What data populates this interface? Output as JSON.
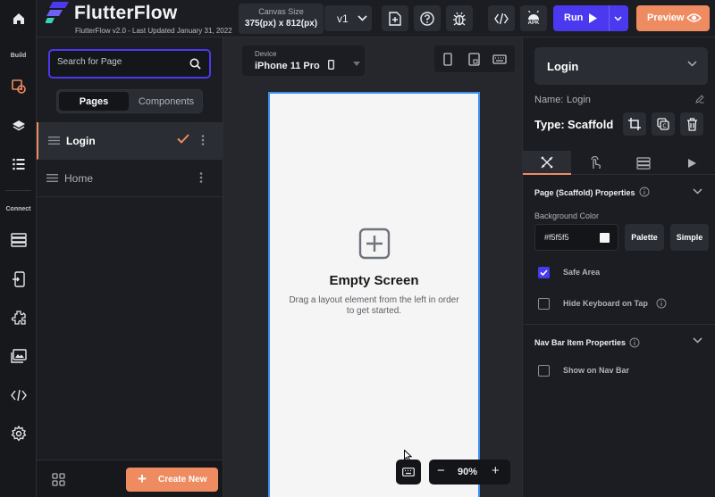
{
  "rail": {
    "build_label": "Build",
    "connect_label": "Connect"
  },
  "header": {
    "brand": "FlutterFlow",
    "version": "FlutterFlow v2.0 - Last Updated January 31, 2022",
    "canvas_size_label": "Canvas Size",
    "canvas_size_value": "375(px) x 812(px)",
    "version_select": "v1",
    "run_label": "Run",
    "preview_label": "Preview",
    "apk_label": "APK"
  },
  "left_panel": {
    "search_placeholder": "Search for Page",
    "tabs": [
      {
        "label": "Pages",
        "active": true
      },
      {
        "label": "Components",
        "active": false
      }
    ],
    "pages": [
      {
        "name": "Login",
        "selected": true
      },
      {
        "name": "Home",
        "selected": false
      }
    ],
    "create_new_label": "Create New"
  },
  "canvas": {
    "device_label": "Device",
    "device_value": "iPhone 11 Pro",
    "empty_title": "Empty Screen",
    "empty_desc": "Drag a layout element from the left in order to get started.",
    "zoom_minus": "−",
    "zoom_value": "90%",
    "zoom_plus": "+"
  },
  "right_panel": {
    "page_select": "Login",
    "name_label": "Name:",
    "name_value": "Login",
    "type_label": "Type:",
    "type_value": "Scaffold",
    "properties_title": "Page (Scaffold) Properties",
    "bg_color_label": "Background Color",
    "bg_color_value": "#f5f5f5",
    "palette_label": "Palette",
    "simple_label": "Simple",
    "safe_area_label": "Safe Area",
    "safe_area_checked": true,
    "hide_keyboard_label": "Hide Keyboard on Tap",
    "hide_keyboard_checked": false,
    "navbar_title": "Nav Bar Item Properties",
    "show_navbar_label": "Show on Nav Bar",
    "show_navbar_checked": false
  },
  "colors": {
    "accent": "#4b39ef",
    "secondary": "#ee8b60",
    "selection": "#3d8ef0",
    "background": "#1b1d22"
  },
  "icons": {
    "rail": [
      "home-icon",
      "theme-icon",
      "layers-icon",
      "list-icon",
      "database-icon",
      "api-icon",
      "settings-puzzle-icon",
      "media-icon",
      "code-icon",
      "gear-icon"
    ]
  }
}
